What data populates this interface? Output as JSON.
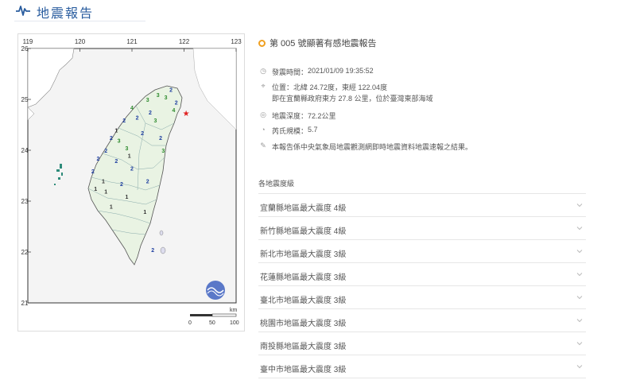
{
  "header": {
    "title": "地震報告",
    "icon": "seismograph-icon",
    "accent_color": "#2a5d9f"
  },
  "map": {
    "lon_ticks": [
      "119",
      "120",
      "121",
      "122",
      "123"
    ],
    "lat_ticks": [
      "26",
      "25",
      "24",
      "23",
      "22",
      "21"
    ],
    "scale_unit": "km",
    "scale_ticks": [
      "0",
      "50",
      "100"
    ],
    "epicenter_marker": "star-icon",
    "epicenter_color": "#e02020",
    "intensity_marks": [
      {
        "v": "4",
        "color": "#2e8b2e",
        "lon": 121.8,
        "lat": 24.75
      },
      {
        "v": "4",
        "color": "#2e8b2e",
        "lon": 121.0,
        "lat": 24.8
      },
      {
        "v": "3",
        "color": "#2e8b2e",
        "lon": 121.65,
        "lat": 25.0
      },
      {
        "v": "3",
        "color": "#2e8b2e",
        "lon": 121.5,
        "lat": 25.05
      },
      {
        "v": "3",
        "color": "#2e8b2e",
        "lon": 121.6,
        "lat": 23.95
      },
      {
        "v": "3",
        "color": "#2e8b2e",
        "lon": 121.3,
        "lat": 24.95
      },
      {
        "v": "3",
        "color": "#2e8b2e",
        "lon": 120.9,
        "lat": 24.0
      },
      {
        "v": "3",
        "color": "#2e8b2e",
        "lon": 120.75,
        "lat": 24.15
      },
      {
        "v": "3",
        "color": "#2e8b2e",
        "lon": 121.45,
        "lat": 24.55
      },
      {
        "v": "2",
        "color": "#1f3fa0",
        "lon": 121.75,
        "lat": 25.15
      },
      {
        "v": "2",
        "color": "#1f3fa0",
        "lon": 121.85,
        "lat": 24.9
      },
      {
        "v": "2",
        "color": "#1f3fa0",
        "lon": 121.35,
        "lat": 24.7
      },
      {
        "v": "2",
        "color": "#1f3fa0",
        "lon": 121.1,
        "lat": 24.6
      },
      {
        "v": "2",
        "color": "#1f3fa0",
        "lon": 120.85,
        "lat": 24.55
      },
      {
        "v": "2",
        "color": "#1f3fa0",
        "lon": 121.55,
        "lat": 24.2
      },
      {
        "v": "2",
        "color": "#1f3fa0",
        "lon": 121.2,
        "lat": 24.3
      },
      {
        "v": "2",
        "color": "#1f3fa0",
        "lon": 120.6,
        "lat": 24.2
      },
      {
        "v": "2",
        "color": "#1f3fa0",
        "lon": 120.5,
        "lat": 23.95
      },
      {
        "v": "2",
        "color": "#1f3fa0",
        "lon": 120.35,
        "lat": 23.8
      },
      {
        "v": "2",
        "color": "#1f3fa0",
        "lon": 120.7,
        "lat": 23.75
      },
      {
        "v": "2",
        "color": "#1f3fa0",
        "lon": 121.0,
        "lat": 23.6
      },
      {
        "v": "2",
        "color": "#1f3fa0",
        "lon": 120.25,
        "lat": 23.55
      },
      {
        "v": "2",
        "color": "#1f3fa0",
        "lon": 121.3,
        "lat": 23.35
      },
      {
        "v": "2",
        "color": "#1f3fa0",
        "lon": 120.8,
        "lat": 23.3
      },
      {
        "v": "2",
        "color": "#1f3fa0",
        "lon": 121.4,
        "lat": 22.0
      },
      {
        "v": "1",
        "color": "#333333",
        "lon": 120.3,
        "lat": 23.2
      },
      {
        "v": "1",
        "color": "#333333",
        "lon": 120.5,
        "lat": 23.15
      },
      {
        "v": "1",
        "color": "#333333",
        "lon": 120.45,
        "lat": 23.35
      },
      {
        "v": "1",
        "color": "#333333",
        "lon": 120.9,
        "lat": 23.05
      },
      {
        "v": "1",
        "color": "#333333",
        "lon": 120.6,
        "lat": 22.85
      },
      {
        "v": "1",
        "color": "#333333",
        "lon": 121.25,
        "lat": 22.75
      },
      {
        "v": "1",
        "color": "#333333",
        "lon": 120.7,
        "lat": 24.35
      },
      {
        "v": "1",
        "color": "#333333",
        "lon": 120.95,
        "lat": 23.85
      }
    ]
  },
  "report": {
    "title": "第 005 號顯著有感地震報告",
    "time_label": "發震時間：",
    "time_value": "2021/01/09 19:35:52",
    "location_label": "位置：",
    "location_value": "北緯 24.72度，東經 122.04度",
    "location_detail": "即在宜蘭縣政府東方 27.8 公里，位於臺灣東部海域",
    "depth_label": "地震深度：",
    "depth_value": "72.2公里",
    "magnitude_label": "芮氏規模：",
    "magnitude_value": "5.7",
    "note": "本報告係中央氣象局地震觀測網即時地震資料地震速報之結果。"
  },
  "intensity": {
    "section_title": "各地震度級",
    "items": [
      "宜蘭縣地區最大震度 4級",
      "新竹縣地區最大震度 4級",
      "新北市地區最大震度 3級",
      "花蓮縣地區最大震度 3級",
      "臺北市地區最大震度 3級",
      "桃園市地區最大震度 3級",
      "南投縣地區最大震度 3級",
      "臺中市地區最大震度 3級"
    ]
  }
}
